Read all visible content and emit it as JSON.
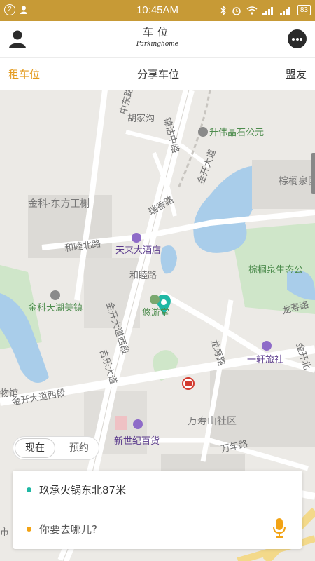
{
  "status_bar": {
    "notification_count": "2",
    "time": "10:45AM",
    "battery": "83",
    "colors": {
      "background": "#c79a36",
      "text": "#ffffff"
    }
  },
  "header": {
    "logo_cn": "车位",
    "logo_en": "Parkinghome",
    "left_icon": "user-icon",
    "right_icon": "chat-bubble-icon"
  },
  "tabs": [
    {
      "label": "租车位",
      "active": true
    },
    {
      "label": "分享车位",
      "active": false
    },
    {
      "label": "盟友",
      "active": false
    }
  ],
  "accent_color": "#e39a1d",
  "map": {
    "labels": {
      "north_road": "中东路",
      "hujiagou": "胡家沟",
      "jinguzhong_road": "锦沽中路",
      "shengwei": "升伟晶石公元",
      "jinkai_avenue": "金开大道",
      "ruixiang_road": "瑞香路",
      "jinke_dongfang": "金科·东方王榭",
      "zonglinquan": "棕榈泉国",
      "hemu_north": "和睦北路",
      "tianlai_hotel": "天来大酒店",
      "hemu_road": "和睦路",
      "zonglin_park": "棕榈泉生态公",
      "jinke_tianhu": "金科天湖美镇",
      "youyou_tang": "悠游堂",
      "longshou_road": "龙寿路",
      "jinkai_west_1": "金开大道西段",
      "jijie_road": "吉乐大道",
      "longshou_road_2": "龙寿路",
      "yixuan_hostel": "一轩旅社",
      "jinkai_north": "金开北",
      "museum": "物馆",
      "jinkai_west_2": "金开大道西段",
      "wanshoushan": "万寿山社区",
      "xinshiji": "新世纪百货",
      "wannian_road": "万年路",
      "market": "市"
    }
  },
  "time_toggle": {
    "now_label": "现在",
    "reserve_label": "预约"
  },
  "location_card": {
    "current_location": "玖承火锅东北87米",
    "current_dot_color": "#1fb8a4",
    "destination_placeholder": "你要去哪儿?",
    "destination_dot_color": "#f2a314",
    "mic_icon": "microphone-icon"
  }
}
